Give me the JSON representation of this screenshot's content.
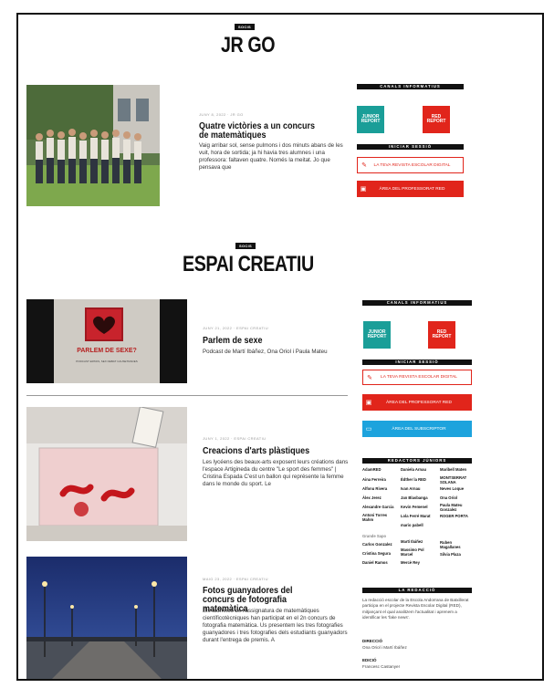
{
  "sections": [
    {
      "tag": "SOCIS",
      "title": "JR GO"
    },
    {
      "tag": "SOCIS",
      "title": "ESPAI CREATIU"
    }
  ],
  "posts": [
    {
      "meta": "JUNY 8, 2022 · JR GO",
      "title": "Quatre victòries a un concurs de matemàtiques",
      "excerpt": "Vaig arribar sol, sense pulmons i dos minuts abans de les vuit, hora de sortida; ja hi havia tres alumnes i una professora: faltaven quatre. Només la meitat. Jo que pensava que"
    },
    {
      "meta": "JUNY 21, 2022 · ESPAI CREATIU",
      "title": "Parlem de sexe",
      "excerpt": "Podcast de Martí Ibáñez, Ona Oriol i Paula Mateu",
      "thumb_title": "PARLEM DE SEXE?",
      "thumb_sub": "PODCAST ERTAIS, SEX DEBAT CAUSETRADES"
    },
    {
      "meta": "JUNY 1, 2022 · ESPAI CREATIU",
      "title": "Creacions d'arts plàstiques",
      "excerpt": "Les lycéens des beaux-arts exposent leurs créations dans l'espace Artigineda du centre \"Le sport des femmes\" | Cristina Espada C'est un ballon qui représente la femme dans le monde du sport. Le"
    },
    {
      "meta": "MAIG 23, 2022 · ESPAI CREATIU",
      "title": "Fotos guanyadores del concurs de fotografia matemàtica",
      "excerpt": "Els alumnes de l'assignatura de matemàtiques científicotècniques han participat en el 2n concurs de fotografia matemàtica. Us presentem les tres fotografies guanyadores i tres fotografies dels estudiants guanyadors durant l'entrega de premis. A"
    }
  ],
  "sidebar": {
    "canals": "CANALS INFORMATIUS",
    "iniciar": "INICIAR SESSIÓ",
    "logo_junior": "JUNIOR REPORT",
    "logo_red": "RED REPORT",
    "btn_revista": "LA TEVA REVISTA ESCOLAR DIGITAL",
    "btn_professorat": "ÀREA DEL PROFESSORAT RED",
    "btn_subscriptor": "ÀREA DEL SUBSCRIPTOR",
    "redactors": "REDACTORS JÚNIORS",
    "names": [
      "AdamRED",
      "Daniela Arnau",
      "Maribell Maten",
      "Aina Ferreira",
      "Èdther la RED",
      "MONTSERRAT SOLANA",
      "Alfonu Rivera",
      "Ivan Arnau",
      "Neves Loque",
      "Àlex Jerez",
      "Jan Blasbanga",
      "Ona Oriol",
      "Alexandre Garcia",
      "Kevin Femenel",
      "Paula Mateu Gonzalez",
      "Antoni Torres Mahm",
      "Lola Ferré Marat",
      "ROGER PORTA",
      "Carlos Gonzalez",
      "Martí Ibáñez",
      "Ruben Magallanes",
      "Cristina Segura",
      "Massimo Pol Marcel",
      "Silvia Plaza",
      "Daniel Ramos",
      "Mercè Rey"
    ],
    "more_name": "mario pabell",
    "partial_name": "Grande Sapo",
    "redaccio": "LA REDACCIÓ",
    "redaccio_text": "La redacció escolar de la Escola Andorrana de Batxillerat participa en el projecte Revista Escolar Digital (RED), mitjançant el qual analitzem l'actualitat i aprenem a identificar les 'fake news'.",
    "direccio_label": "DIRECCIÓ",
    "direccio_value": "Ona Oriol i Martí Ibáñez",
    "edicio_label": "EDICIÓ",
    "edicio_value": "Francesc Castanyer"
  },
  "colors": {
    "red": "#e1251b",
    "teal": "#1a9e98",
    "blue": "#1da3dd"
  }
}
